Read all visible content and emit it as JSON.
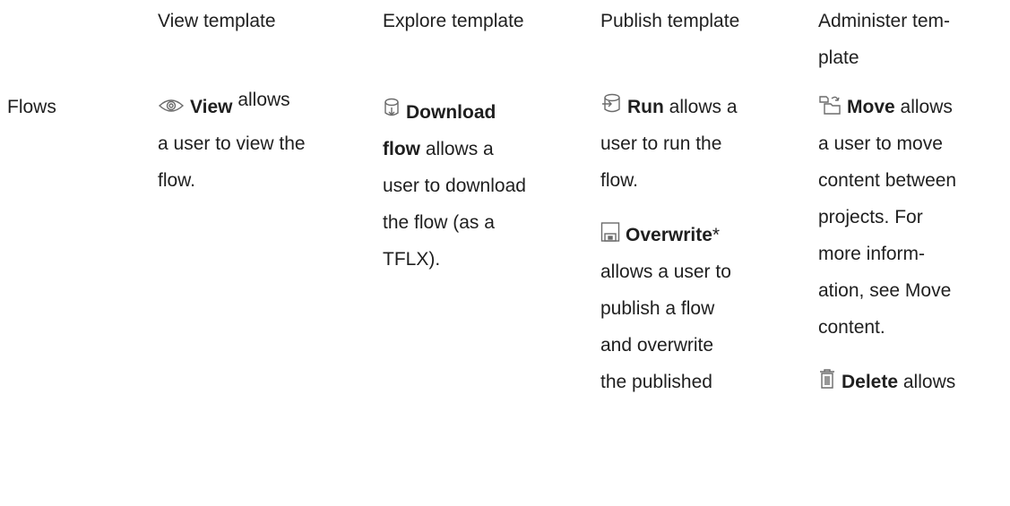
{
  "headers": {
    "view": "View template",
    "explore": "Explore template",
    "publish": "Publish template",
    "administer_line1": "Administer tem-",
    "administer_line2": "plate"
  },
  "row_label": "Flows",
  "view_col": {
    "icon": "eye-icon",
    "term": "View",
    "text_a": "allows",
    "text_b": "a user to view the",
    "text_c": "flow."
  },
  "explore_col": {
    "icon": "download-flow-icon",
    "term_a": "Download",
    "term_b": "flow",
    "text_a": "allows a",
    "text_b": "user to download",
    "text_c": "the flow (as a",
    "text_d": "TFLX)."
  },
  "publish_col": {
    "run": {
      "icon": "run-flow-icon",
      "term": "Run",
      "text_a": "allows a",
      "text_b": "user to run the",
      "text_c": "flow."
    },
    "overwrite": {
      "icon": "save-icon",
      "term": "Overwrite",
      "star": "*",
      "text_a": "allows a user to",
      "text_b": "publish a flow",
      "text_c": "and overwrite",
      "text_d": "the published"
    }
  },
  "administer_col": {
    "move": {
      "icon": "move-icon",
      "term": "Move",
      "text_a": "allows",
      "text_b": "a user to move",
      "text_c": "content between",
      "text_d": "projects. For",
      "text_e": "more inform-",
      "text_f": "ation, see Move",
      "text_g": "content."
    },
    "delete": {
      "icon": "trash-icon",
      "term": "Delete",
      "text_a": "allows"
    }
  }
}
